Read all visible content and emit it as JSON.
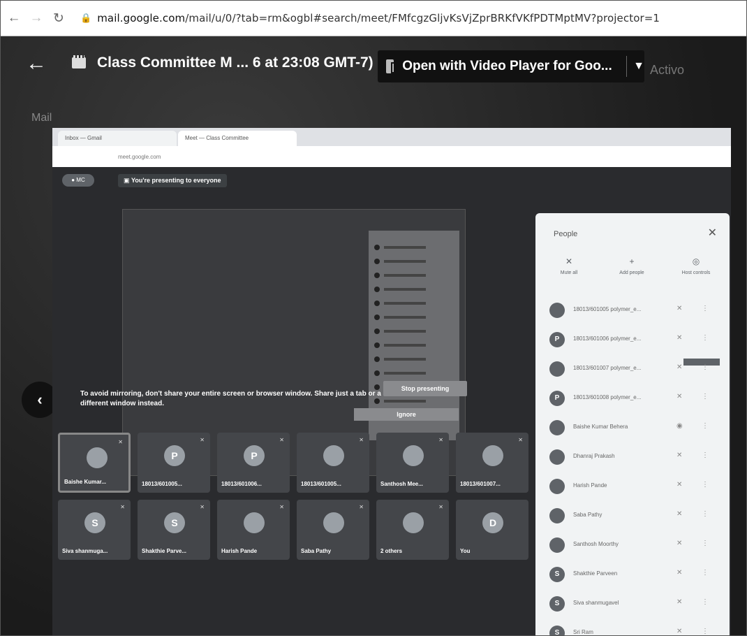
{
  "browser": {
    "url_prefix": "mail.google.com",
    "url_rest": "/mail/u/0/?tab=rm&ogbl#search/meet/FMfcgzGljvKsVjZprBRKfVKfPDTMptMV?projector=1"
  },
  "viewer": {
    "doc_title": "Class Committee M ... 6 at 23:08 GMT-7)",
    "open_with_label": "Open with Video Player for Goo...",
    "activo_label": "Activo",
    "mail_label": "Mail"
  },
  "meet": {
    "presenting_banner": "You're presenting to everyone",
    "warning_text": "To avoid mirroring, don't share your entire screen or browser window. Share just a tab or a different window instead.",
    "stop_presenting": "Stop presenting",
    "ignore": "Ignore",
    "tiles": [
      {
        "name": "Baishe Kumar...",
        "initial": ""
      },
      {
        "name": "18013/601005...",
        "initial": "P"
      },
      {
        "name": "18013/601006...",
        "initial": "P"
      },
      {
        "name": "18013/601005...",
        "initial": ""
      },
      {
        "name": "Santhosh Mee...",
        "initial": ""
      },
      {
        "name": "18013/601007...",
        "initial": ""
      },
      {
        "name": "Siva shanmuga...",
        "initial": "S"
      },
      {
        "name": "Shakthie Parve...",
        "initial": "S"
      },
      {
        "name": "Harish Pande",
        "initial": ""
      },
      {
        "name": "Saba Pathy",
        "initial": ""
      },
      {
        "name": "2 others",
        "initial": ""
      },
      {
        "name": "You",
        "initial": "D"
      }
    ]
  },
  "people_panel": {
    "title": "People",
    "actions": [
      "Mute all",
      "Add people",
      "Host controls"
    ],
    "participants": [
      {
        "name": "18013/601005 polymer_e...",
        "initial": ""
      },
      {
        "name": "18013/601006 polymer_e...",
        "initial": "P"
      },
      {
        "name": "18013/601007 polymer_e...",
        "initial": ""
      },
      {
        "name": "18013/601008 polymer_e...",
        "initial": "P"
      },
      {
        "name": "Baishe Kumar Behera",
        "initial": ""
      },
      {
        "name": "Dhanraj Prakash",
        "initial": ""
      },
      {
        "name": "Harish Pande",
        "initial": ""
      },
      {
        "name": "Saba Pathy",
        "initial": ""
      },
      {
        "name": "Santhosh Moorthy",
        "initial": ""
      },
      {
        "name": "Shakthie Parveen",
        "initial": "S"
      },
      {
        "name": "Siva shanmugavel",
        "initial": "S"
      },
      {
        "name": "Sri Ram",
        "initial": "S"
      }
    ]
  }
}
